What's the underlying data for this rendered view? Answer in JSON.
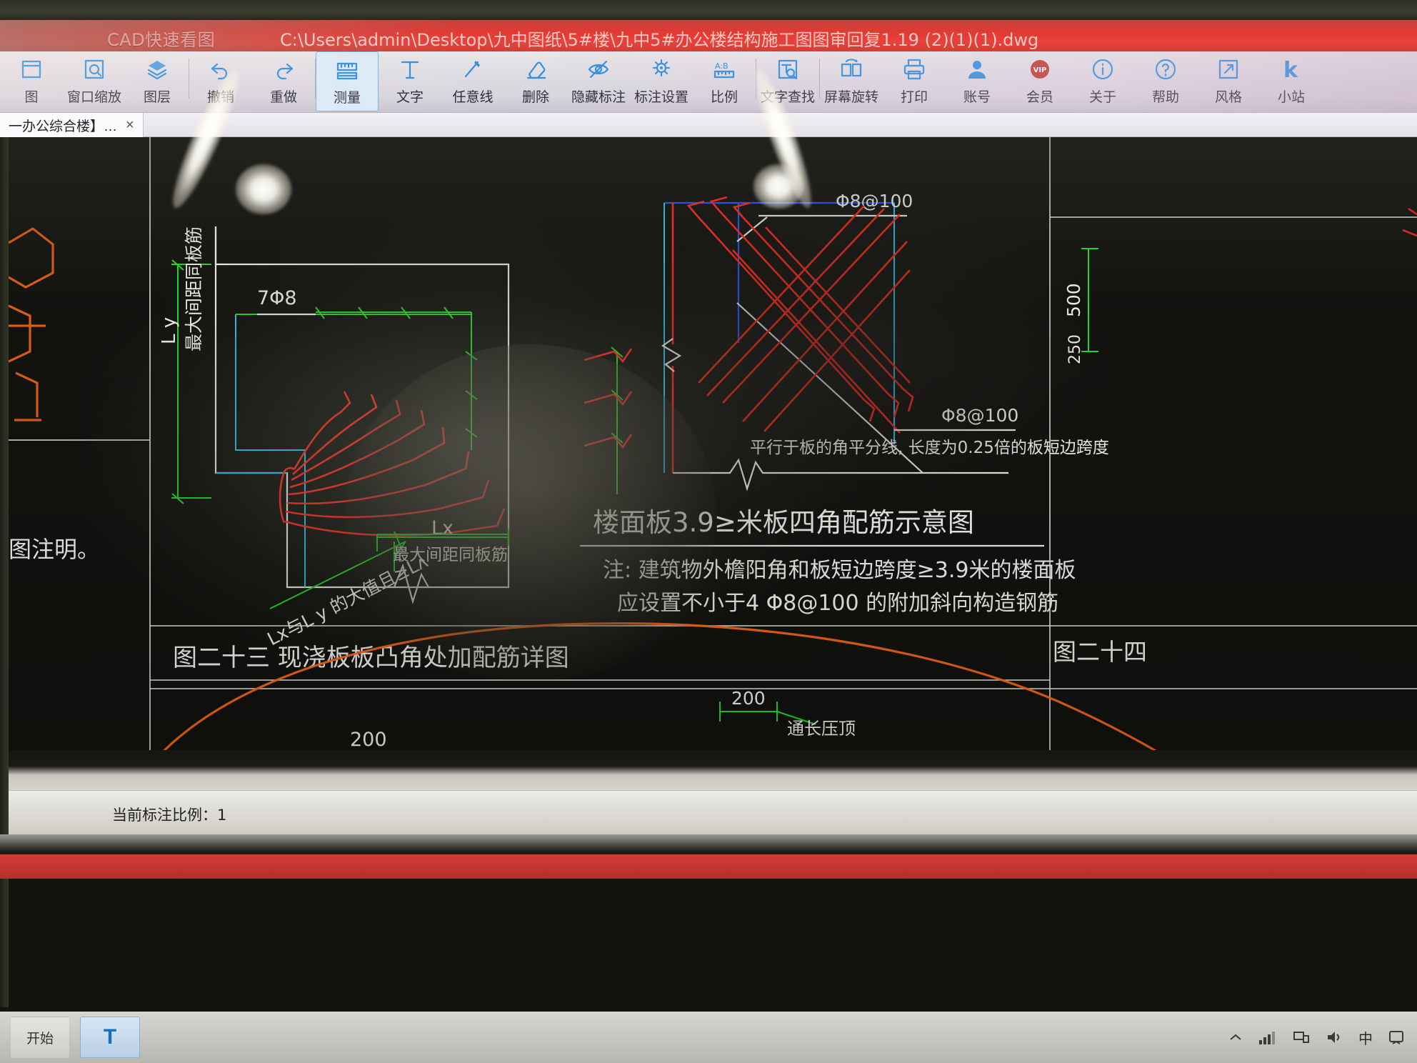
{
  "app": {
    "name": "CAD快速看图",
    "file_path": "C:\\Users\\admin\\Desktop\\九中图纸\\5#楼\\九中5#办公楼结构施工图图审回复1.19 (2)(1)(1).dwg"
  },
  "toolbar": {
    "items": [
      {
        "label": "图",
        "icon": "open-drawing-icon",
        "selected": false
      },
      {
        "label": "窗口缩放",
        "icon": "zoom-window-icon",
        "selected": false
      },
      {
        "label": "图层",
        "icon": "layers-icon",
        "selected": false
      },
      {
        "label": "撤销",
        "icon": "undo-icon",
        "selected": false
      },
      {
        "label": "重做",
        "icon": "redo-icon",
        "selected": false
      },
      {
        "label": "测量",
        "icon": "measure-icon",
        "selected": true
      },
      {
        "label": "文字",
        "icon": "text-icon",
        "selected": false
      },
      {
        "label": "任意线",
        "icon": "freeline-icon",
        "selected": false
      },
      {
        "label": "删除",
        "icon": "eraser-icon",
        "selected": false
      },
      {
        "label": "隐藏标注",
        "icon": "hide-dimension-icon",
        "selected": false
      },
      {
        "label": "标注设置",
        "icon": "dimension-settings-icon",
        "selected": false
      },
      {
        "label": "比例",
        "icon": "scale-icon",
        "selected": false
      },
      {
        "label": "文字查找",
        "icon": "text-search-icon",
        "selected": false
      },
      {
        "label": "屏幕旋转",
        "icon": "screen-rotate-icon",
        "selected": false
      },
      {
        "label": "打印",
        "icon": "print-icon",
        "selected": false
      },
      {
        "label": "账号",
        "icon": "account-icon",
        "selected": false
      },
      {
        "label": "会员",
        "icon": "vip-icon",
        "selected": false
      },
      {
        "label": "关于",
        "icon": "info-icon",
        "selected": false
      },
      {
        "label": "帮助",
        "icon": "help-icon",
        "selected": false
      },
      {
        "label": "风格",
        "icon": "style-icon",
        "selected": false
      },
      {
        "label": "小站",
        "icon": "kuaikan-k-icon",
        "selected": false
      }
    ]
  },
  "tabs": [
    {
      "label": "一办公综合楼】…",
      "close": "×",
      "active": true
    }
  ],
  "drawing": {
    "left_detail": {
      "title": "图二十三  现浇板板凸角处加配筋详图",
      "labels": {
        "rebar_count": "7Φ8",
        "dim_ly": "L y",
        "dim_lx": "Lx",
        "spacing_v": "最大间距同板筋",
        "spacing_h": "最大间距同板筋",
        "length_note": "Lx与L y 的大值且≥Lʌ"
      }
    },
    "right_detail": {
      "title": "楼面板3.9≥米板四角配筋示意图",
      "labels": {
        "rebar_top": "Φ8@100",
        "rebar_side": "Φ8@100",
        "bisector_note": "平行于板的角平分线, 长度为0.25倍的板短边跨度"
      },
      "notes": [
        "注: 建筑物外檐阳角和板短边跨度≥3.9米的楼面板",
        "应设置不小于4 Φ8@100 的附加斜向构造钢筋"
      ]
    },
    "bottom_detail": {
      "dim_200_a": "200",
      "dim_200_b": "200",
      "label_through": "通长压顶"
    },
    "far_left": {
      "note": "图注明。"
    },
    "far_right": {
      "title": "图二十四",
      "dim_500": "500",
      "dim_250": "250"
    }
  },
  "status": {
    "scale_label": "当前标注比例：1"
  },
  "taskbar": {
    "start_label": "开始",
    "app_button": "T",
    "ime_label": "中",
    "tray_icons": [
      "chevron-up-icon",
      "signal-icon",
      "network-icon",
      "volume-icon",
      "ime-icon",
      "notification-icon"
    ]
  },
  "colors": {
    "title_bar": "#e0403a",
    "accent_blue": "#2f8fe0",
    "cad_red": "#ff2a20",
    "cad_green": "#22e022",
    "cad_cyan": "#28c8f0",
    "cad_blue": "#2a54ff",
    "cad_white": "#f2f2ee",
    "cad_orange": "#ff6a18"
  }
}
